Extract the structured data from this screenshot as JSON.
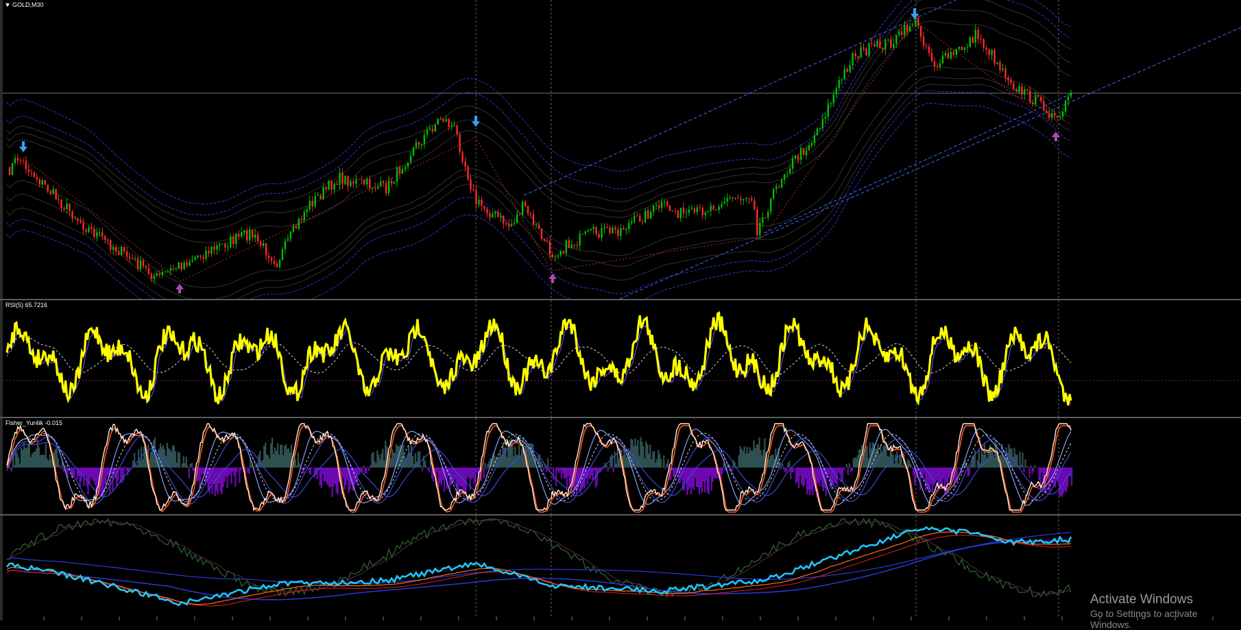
{
  "window": {
    "symbol_title": "GOLD,M30",
    "arrow_icon": "triangle-down-icon"
  },
  "panes": {
    "price": {
      "label": "GOLD,M30"
    },
    "rsi": {
      "label": "RSI(5) 65.7216",
      "value": 65.7216
    },
    "fisher": {
      "label": "Fisher_Yur4ik -0.015",
      "value": -0.015
    },
    "ma": {
      "label": ""
    }
  },
  "colors": {
    "background": "#000000",
    "bull_candle": "#00c000",
    "bear_candle": "#ff2a2a",
    "rsi_line": "#ffff00",
    "rsi_signal": "#6a5cff",
    "fisher_white": "#fff0dc",
    "fisher_orange": "#ff5a1e",
    "fisher_hist_pos": "#2e5050",
    "fisher_hist_neg": "#6a0ab0",
    "ma_cyan": "#1ec8ff",
    "ma_orange": "#ff6a1e",
    "ma_blue": "#2a3ad8",
    "ma_green": "#2e6a2e",
    "channel_blue": "#3a3ae8",
    "trend_dashed": "#3a6aff",
    "arrow_up": "#3aa0ff",
    "arrow_down": "#b04ab0",
    "crosshair": "#c0c0c0"
  },
  "watermark": {
    "title": "Activate Windows",
    "subtitle": "Go to Settings to activate Windows."
  },
  "markers": {
    "sell_arrow_icon": "blue-down-arrow-icon",
    "buy_arrow_icon": "magenta-up-arrow-icon"
  }
}
